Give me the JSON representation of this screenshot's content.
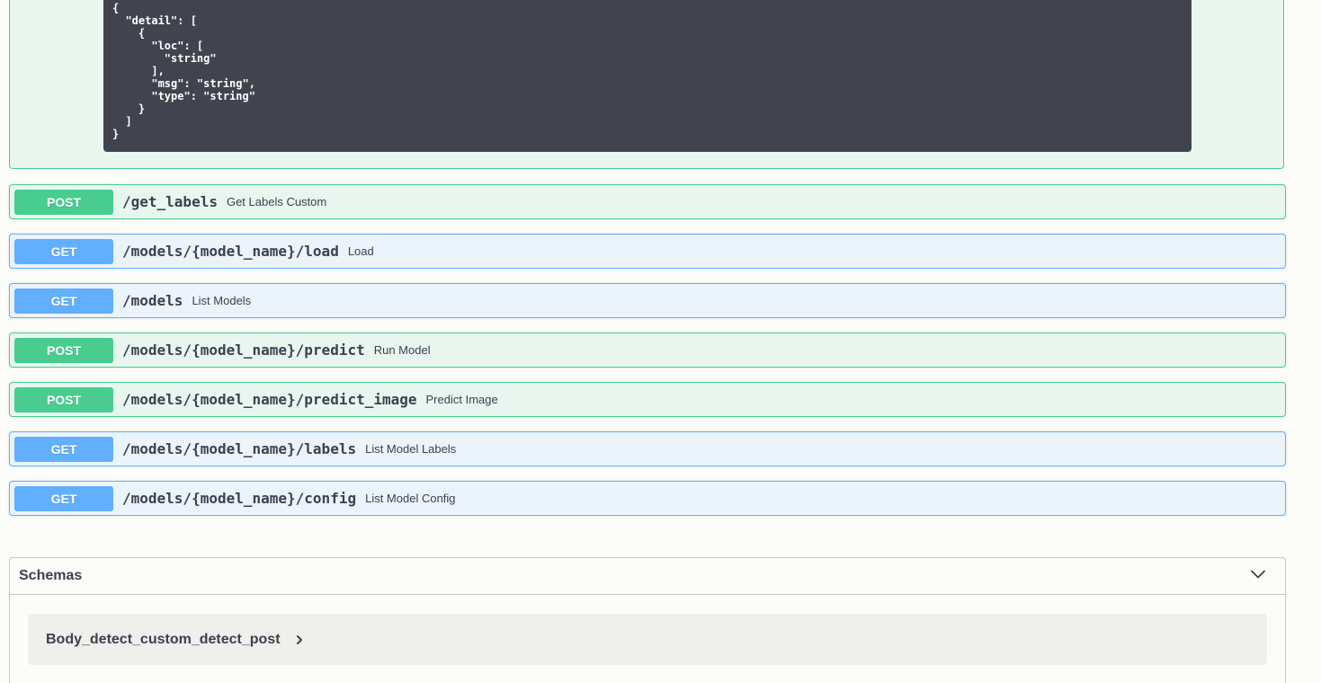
{
  "response_example": {
    "code": "{\n  \"detail\": [\n    {\n      \"loc\": [\n        \"string\"\n      ],\n      \"msg\": \"string\",\n      \"type\": \"string\"\n    }\n  ]\n}"
  },
  "operations": [
    {
      "method": "POST",
      "path": "/get_labels",
      "summary": "Get Labels Custom"
    },
    {
      "method": "GET",
      "path": "/models/{model_name}/load",
      "summary": "Load"
    },
    {
      "method": "GET",
      "path": "/models",
      "summary": "List Models"
    },
    {
      "method": "POST",
      "path": "/models/{model_name}/predict",
      "summary": "Run Model"
    },
    {
      "method": "POST",
      "path": "/models/{model_name}/predict_image",
      "summary": "Predict Image"
    },
    {
      "method": "GET",
      "path": "/models/{model_name}/labels",
      "summary": "List Model Labels"
    },
    {
      "method": "GET",
      "path": "/models/{model_name}/config",
      "summary": "List Model Config"
    }
  ],
  "schemas": {
    "title": "Schemas",
    "models": [
      {
        "name": "Body_detect_custom_detect_post"
      }
    ]
  },
  "icons": {
    "schemas_toggle": "chevron-down-icon",
    "model_toggle": "chevron-right-icon"
  },
  "colors": {
    "post": "#49cc90",
    "get": "#61affe",
    "code_bg": "#41444e"
  }
}
